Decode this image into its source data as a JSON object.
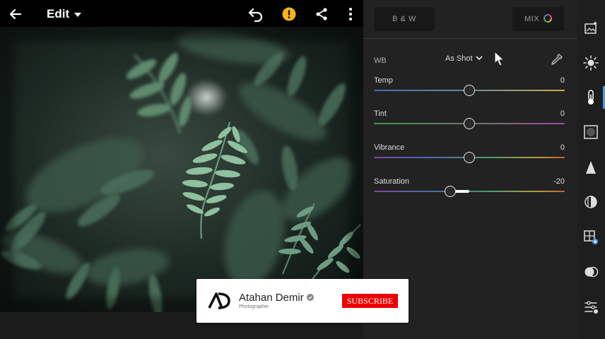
{
  "topbar": {
    "edit_label": "Edit"
  },
  "panel": {
    "bw_label": "B & W",
    "mix_label": "MIX",
    "wb_label": "WB",
    "wb_value": "As Shot",
    "sliders": [
      {
        "name": "Temp",
        "value": "0",
        "position": 0.5
      },
      {
        "name": "Tint",
        "value": "0",
        "position": 0.5
      },
      {
        "name": "Vibrance",
        "value": "0",
        "position": 0.5
      },
      {
        "name": "Saturation",
        "value": "-20",
        "position": 0.4
      }
    ]
  },
  "subscribe_card": {
    "channel_name": "Atahan Demir",
    "role": "Photographer",
    "button_label": "SUBSCRIBE"
  },
  "colors": {
    "warning": "#f5b51b",
    "accent": "#4a9be8",
    "subscribe_red": "#e00000"
  },
  "icons": {
    "topbar": [
      "back-arrow-icon",
      "chevron-down-icon",
      "undo-icon",
      "warning-icon",
      "share-icon",
      "more-vertical-icon"
    ],
    "toolstrip": [
      "presets-icon",
      "light-icon",
      "color-icon",
      "effects-icon",
      "detail-icon",
      "optics-icon",
      "geometry-icon",
      "masking-icon",
      "adjustments-icon"
    ]
  }
}
